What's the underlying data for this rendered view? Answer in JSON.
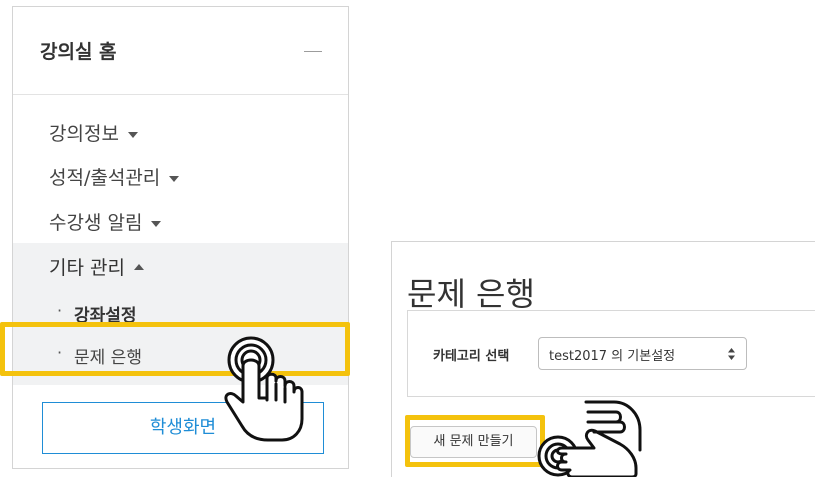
{
  "left_panel": {
    "title": "강의실 홈",
    "menu": [
      {
        "label": "강의정보"
      },
      {
        "label": "성적/출석관리"
      },
      {
        "label": "수강생 알림"
      },
      {
        "label": "기타 관리"
      }
    ],
    "sub_items": [
      {
        "bullet": "·",
        "label": "강좌설정"
      },
      {
        "bullet": "·",
        "label": "문제 은행"
      }
    ],
    "student_view_button": "학생화면"
  },
  "question_bank": {
    "title": "문제 은행",
    "category_label": "카테고리 선택",
    "category_value": "test2017 의 기본설정",
    "new_question_button": "새 문제 만들기"
  },
  "icons": {
    "collapse": "minus-icon",
    "dropdown": "chevron-down-icon",
    "expanded": "chevron-up-icon",
    "select": "up-down-arrow-icon",
    "pointer": "hand-pointer-icon"
  },
  "colors": {
    "highlight": "#f4c20d",
    "accent": "#1f8dd6",
    "expanded_bg": "#f1f2f3"
  }
}
